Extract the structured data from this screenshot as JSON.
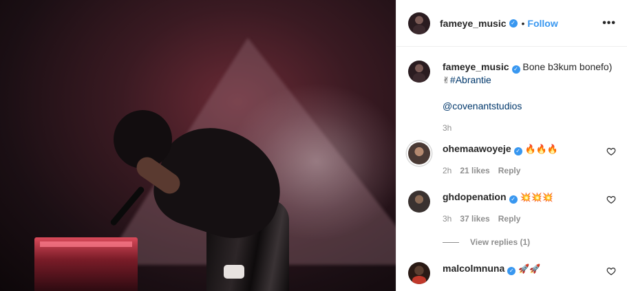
{
  "post": {
    "author": "fameye_music",
    "follow_label": "Follow",
    "separator": "•",
    "more_label": "•••"
  },
  "caption": {
    "author": "fameye_music",
    "text": "Bone b3kum bonefo)",
    "emoji": "✌",
    "hashtag": "#Abrantie",
    "mention": "@covenantstudios",
    "time": "3h"
  },
  "comments": [
    {
      "user": "ohemaawoyeje",
      "text": "🔥🔥🔥",
      "time": "2h",
      "likes": "21 likes",
      "reply": "Reply"
    },
    {
      "user": "ghdopenation",
      "text": "💥💥💥",
      "time": "3h",
      "likes": "37 likes",
      "reply": "Reply"
    },
    {
      "user": "malcolmnuna",
      "text": "🚀🚀",
      "time": "",
      "likes": "",
      "reply": ""
    }
  ],
  "view_replies": "View replies (1)",
  "colors": {
    "link": "#3897f0",
    "hashtag": "#00376b",
    "muted": "#8e8e8e"
  },
  "icons": [
    "verified-badge-icon",
    "more-options-icon",
    "heart-icon"
  ]
}
